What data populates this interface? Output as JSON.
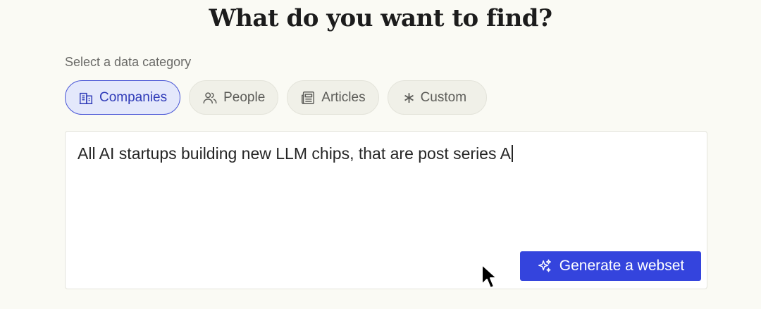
{
  "heading": "What do you want to find?",
  "category_label": "Select a data category",
  "categories": [
    {
      "label": "Companies",
      "icon": "building-icon",
      "active": true
    },
    {
      "label": "People",
      "icon": "people-icon",
      "active": false
    },
    {
      "label": "Articles",
      "icon": "newspaper-icon",
      "active": false
    },
    {
      "label": "Custom",
      "icon": "asterisk-icon",
      "active": false
    }
  ],
  "query": {
    "value": "All AI startups building new LLM chips, that are post series A"
  },
  "generate_button": {
    "label": "Generate a webset",
    "icon": "sparkles-icon"
  },
  "colors": {
    "background": "#fafaf4",
    "accent": "#3444dd",
    "active_chip_bg": "#e4e8fb"
  }
}
